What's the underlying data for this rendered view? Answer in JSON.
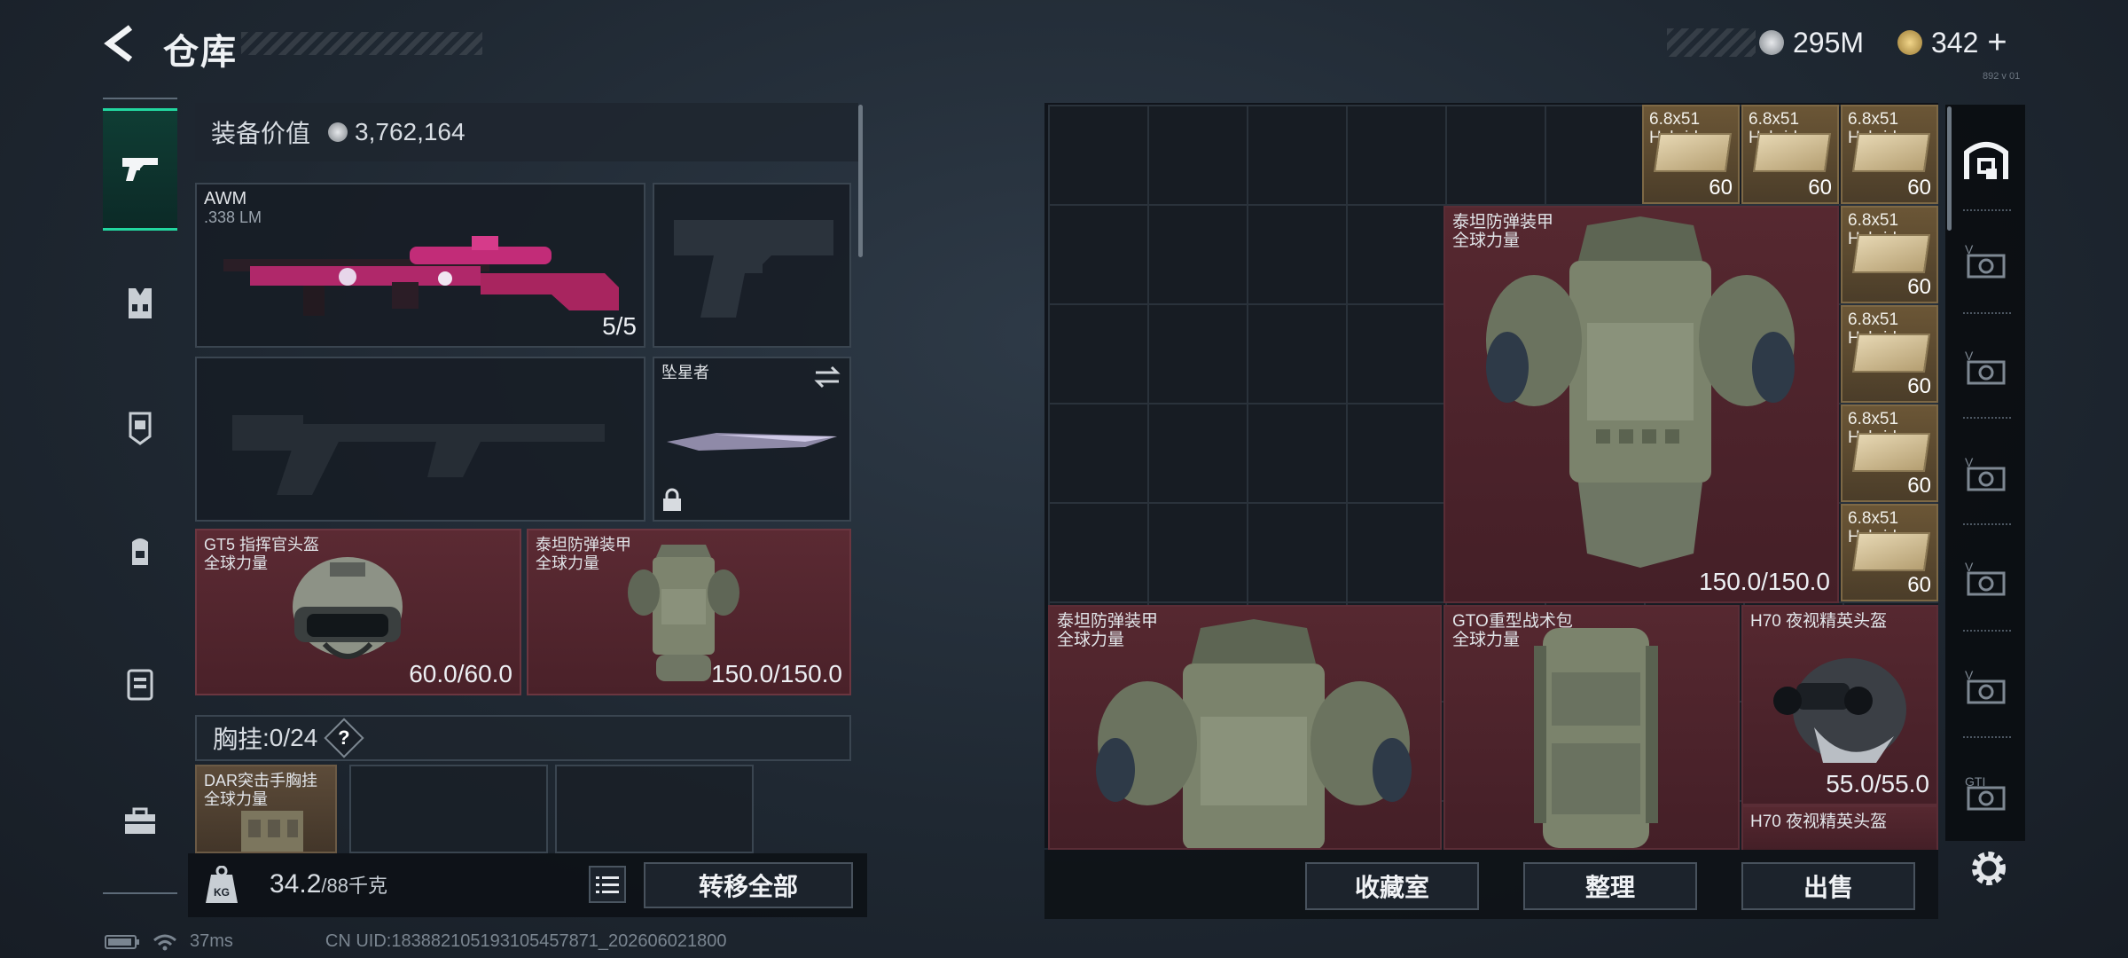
{
  "header": {
    "title": "仓库",
    "currency_1": "295M",
    "currency_2": "342",
    "currency_2_plus": "+",
    "top_right_tiny": "892 v 01"
  },
  "left_nav": {
    "items": [
      "pistol-icon",
      "vest-icon",
      "armor-icon",
      "backpack-icon",
      "case-icon",
      "toolbox-icon"
    ]
  },
  "left_panel": {
    "value_label": "装备价值",
    "value": "3,762,164",
    "primary": {
      "name": "AWM",
      "sub": ".338 LM",
      "count": "5/5"
    },
    "melee": {
      "name": "坠星者"
    },
    "helmet": {
      "name": "GT5 指挥官头盔",
      "sub": "全球力量",
      "durability": "60.0/60.0"
    },
    "armor": {
      "name": "泰坦防弹装甲",
      "sub": "全球力量",
      "durability": "150.0/150.0"
    },
    "chest_rig": {
      "label": "胸挂",
      "sep": ":",
      "capacity": "0/24",
      "help": "?"
    },
    "chest_item": {
      "name": "DAR突击手胸挂",
      "sub": "全球力量"
    },
    "weight": {
      "current": "34.2",
      "max": "/88千克"
    },
    "transfer_all": "转移全部"
  },
  "right_panel": {
    "ammo_label": "6.8x51",
    "ammo_sub": "Hybrid",
    "ammo_count": "60",
    "big_armor": {
      "name": "泰坦防弹装甲",
      "sub": "全球力量",
      "durability": "150.0/150.0"
    },
    "armor2": {
      "name": "泰坦防弹装甲",
      "sub": "全球力量"
    },
    "bag": {
      "name": "GTO重型战术包",
      "sub": "全球力量"
    },
    "helmet_h70": {
      "name": "H70 夜视精英头盔",
      "durability": "55.0/55.0"
    },
    "helmet_h70_2": {
      "name": "H70 夜视精英头盔"
    },
    "buttons": {
      "collect": "收藏室",
      "organize": "整理",
      "sell": "出售"
    }
  },
  "status": {
    "ping": "37ms",
    "uid": "CN UID:183882105193105457871_202606021800"
  },
  "colors": {
    "accent_green": "#22d7a0",
    "item_red": "#562830",
    "ammo_gold": "#6b5636"
  }
}
